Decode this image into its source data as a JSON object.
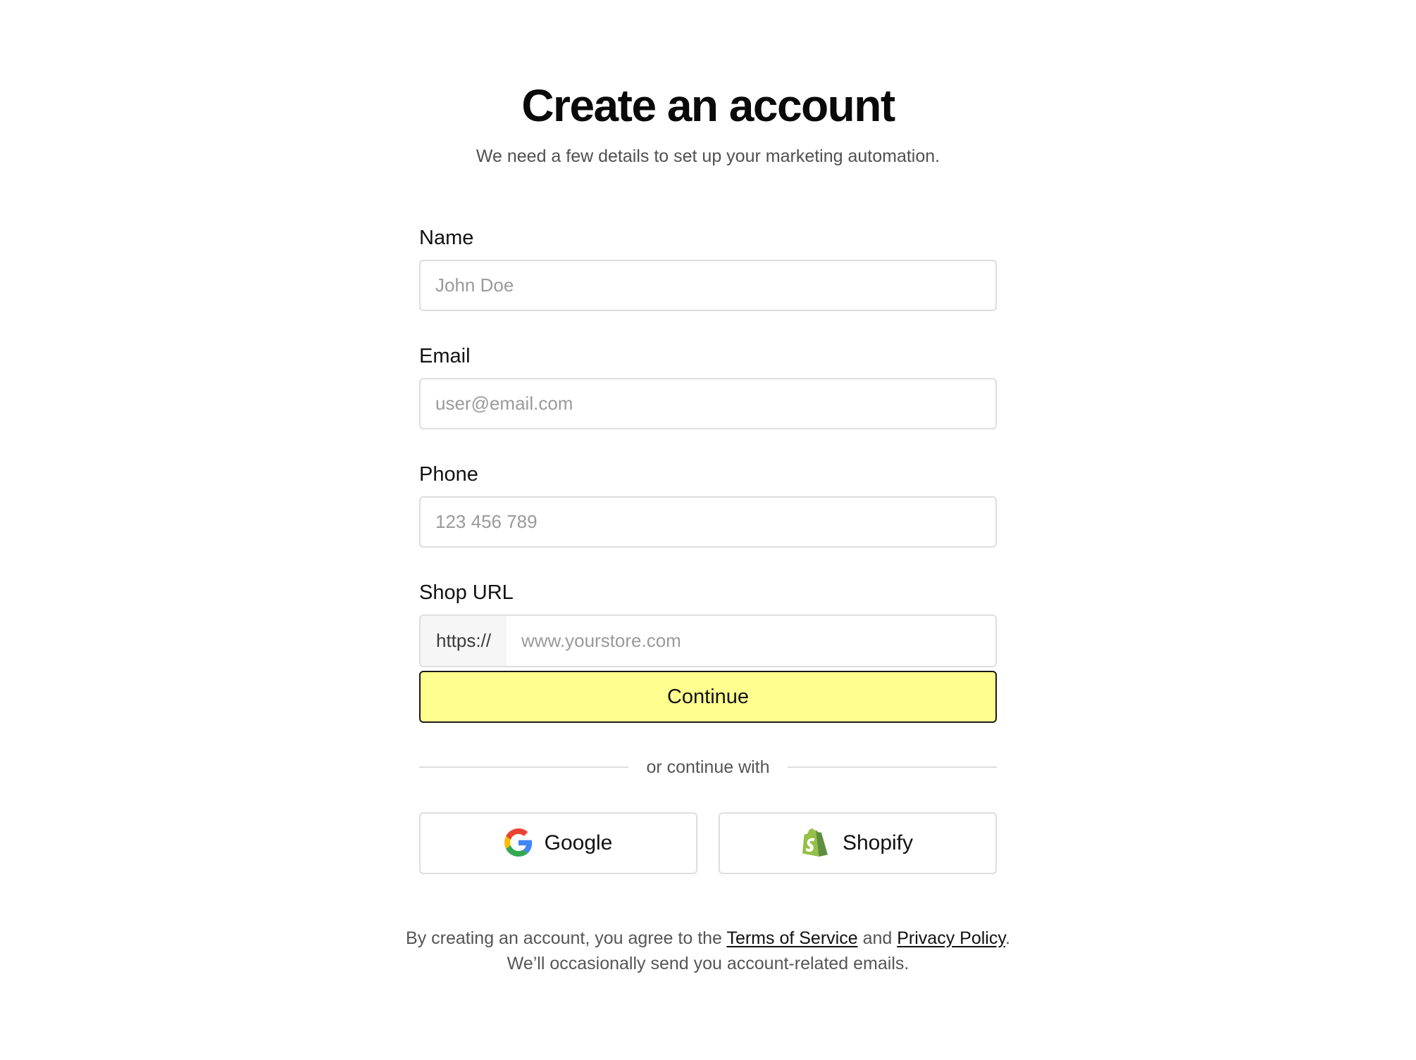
{
  "header": {
    "title": "Create an account",
    "subtitle": "We need a few details to set up your marketing automation."
  },
  "form": {
    "name": {
      "label": "Name",
      "placeholder": "John Doe",
      "value": ""
    },
    "email": {
      "label": "Email",
      "placeholder": "user@email.com",
      "value": ""
    },
    "phone": {
      "label": "Phone",
      "placeholder": "123 456 789",
      "value": ""
    },
    "shop_url": {
      "label": "Shop URL",
      "prefix": "https://",
      "placeholder": "www.yourstore.com",
      "value": ""
    },
    "continue_label": "Continue"
  },
  "divider": {
    "text": "or continue with"
  },
  "social": {
    "google": {
      "label": "Google",
      "icon": "google-icon"
    },
    "shopify": {
      "label": "Shopify",
      "icon": "shopify-icon"
    }
  },
  "legal": {
    "line1_prefix": "By creating an account, you agree to the",
    "terms_link": "Terms of Service",
    "and": "and",
    "privacy_link": "Privacy Policy",
    "period": ".",
    "line2": "We’ll occasionally send you account-related emails."
  },
  "colors": {
    "accent": "#ffff8f",
    "border": "#dedede",
    "text": "#0a0a0a",
    "muted": "#555555"
  }
}
